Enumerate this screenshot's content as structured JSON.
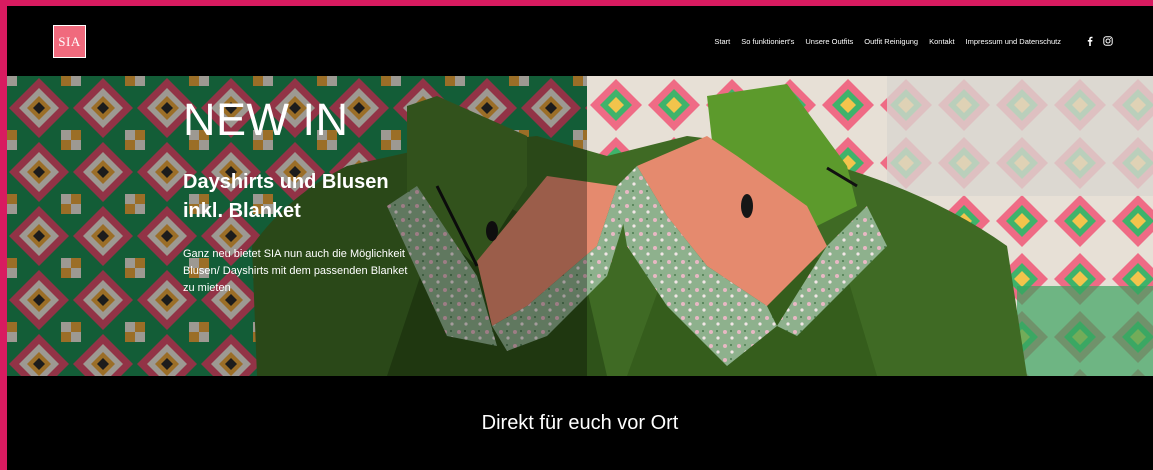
{
  "logo": {
    "text": "SIA"
  },
  "nav": {
    "items": [
      {
        "label": "Start"
      },
      {
        "label": "So funktioniert's"
      },
      {
        "label": "Unsere Outfits"
      },
      {
        "label": "Outfit Reinigung"
      },
      {
        "label": "Kontakt"
      },
      {
        "label": "Impressum und Datenschutz"
      }
    ],
    "social": [
      "facebook-icon",
      "instagram-icon"
    ]
  },
  "hero": {
    "title": "NEW IN",
    "subtitle": "Dayshirts und Blusen inkl. Blanket",
    "text": "Ganz neu bietet SIA nun auch die Möglichkeit Blusen/ Dayshirts mit dem passenden Blanket zu mieten"
  },
  "section": {
    "title": "Direkt für euch vor Ort"
  },
  "colors": {
    "frame": "#d81b60",
    "logo_bg": "#f06a7d",
    "background": "#000000"
  }
}
